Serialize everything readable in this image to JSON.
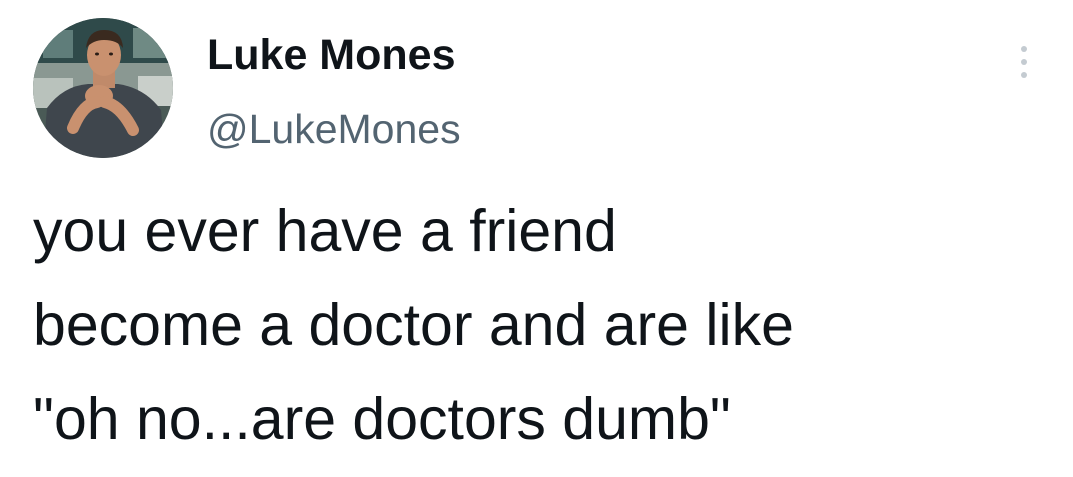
{
  "author": {
    "display_name": "Luke Mones",
    "handle": "@LukeMones",
    "avatar_icon": "profile-photo"
  },
  "menu": {
    "icon": "more-options-icon"
  },
  "tweet": {
    "lines": [
      "you ever have a friend",
      "become a doctor and are like",
      "\"oh no...are doctors dumb\""
    ]
  },
  "colors": {
    "text": "#0f1419",
    "handle": "#536471",
    "menu_dots": "#c4cbd1",
    "background": "#ffffff"
  }
}
